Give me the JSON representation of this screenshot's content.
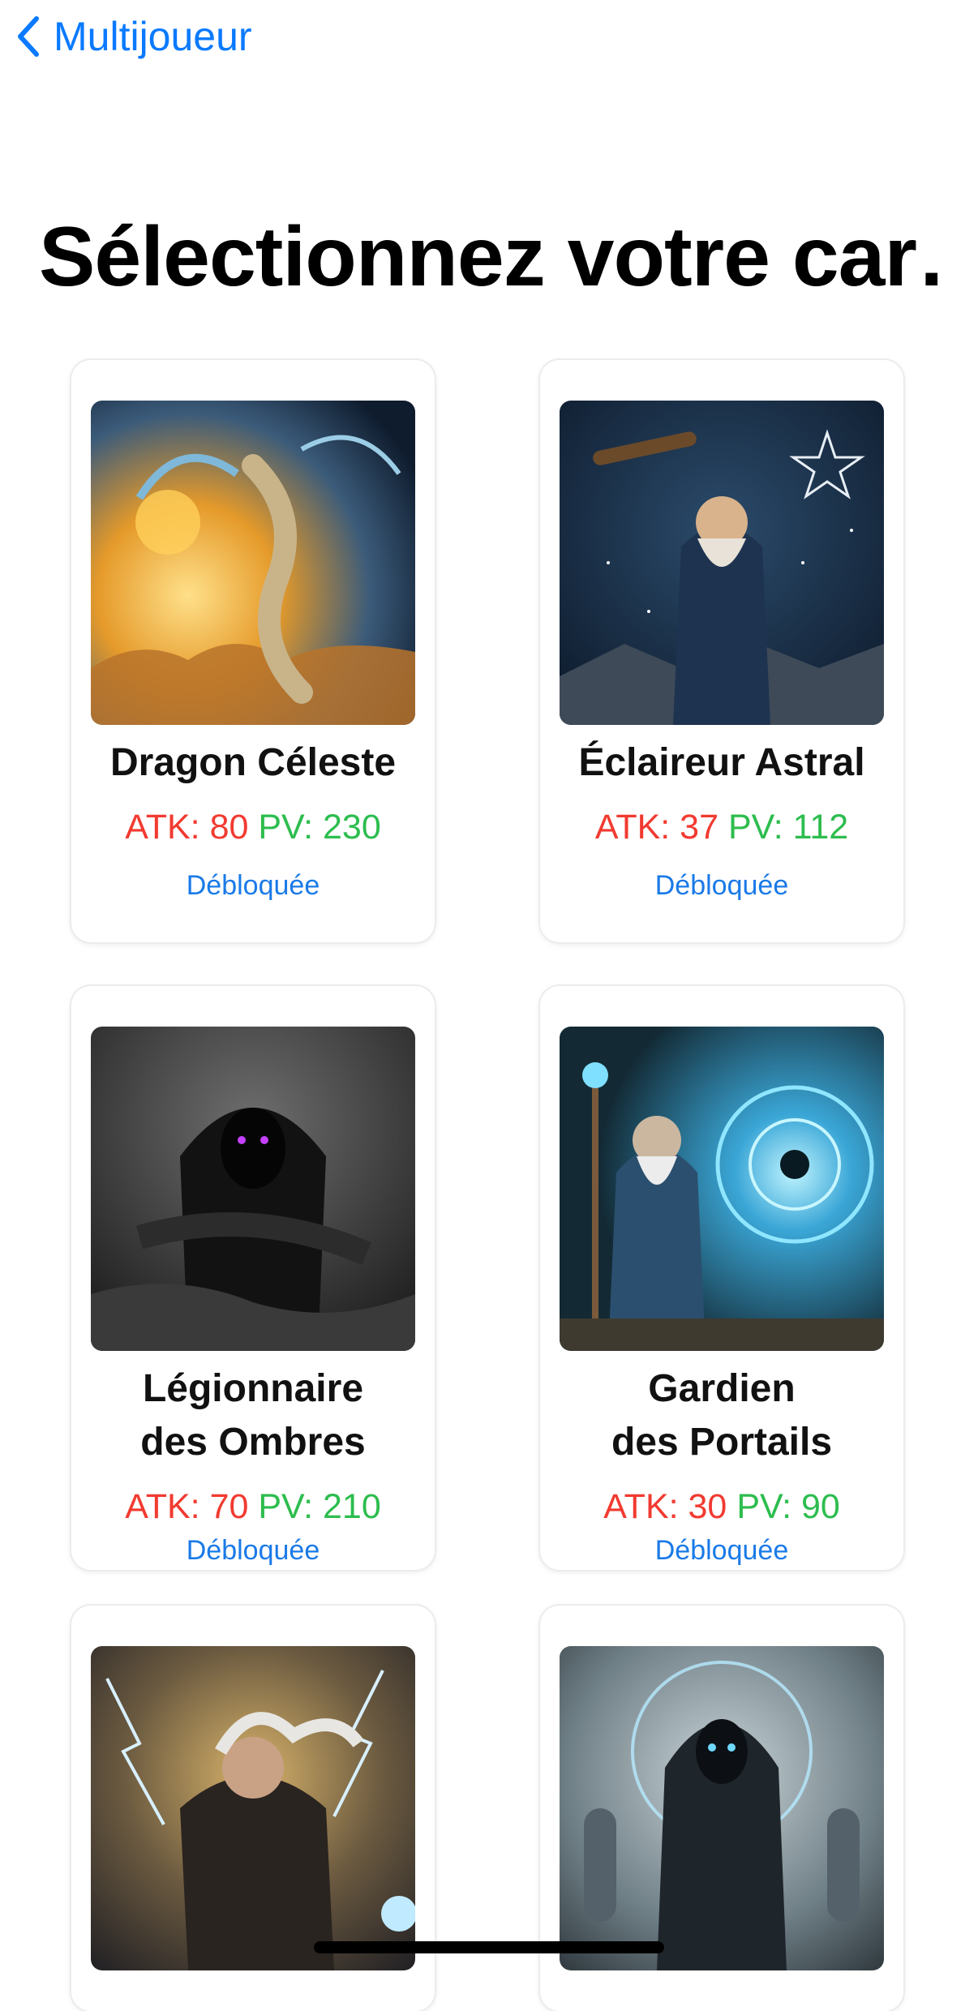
{
  "nav": {
    "back_label": "Multijoueur"
  },
  "page": {
    "title": "Sélectionnez votre car…"
  },
  "cards": [
    {
      "name": "Dragon Céleste",
      "atk_label": "ATK: 80",
      "pv_label": "PV: 230",
      "status": "Débloquée"
    },
    {
      "name": "Éclaireur Astral",
      "atk_label": "ATK: 37",
      "pv_label": "PV: 112",
      "status": "Débloquée"
    },
    {
      "name_line1": "Légionnaire",
      "name_line2": "des Ombres",
      "atk_label": "ATK: 70",
      "pv_label": "PV: 210",
      "status": "Débloquée"
    },
    {
      "name_line1": "Gardien",
      "name_line2": "des Portails",
      "atk_label": "ATK: 30",
      "pv_label": "PV: 90",
      "status": "Débloquée"
    },
    {},
    {}
  ],
  "colors": {
    "accent": "#0a7aff",
    "atk": "#f23a30",
    "pv": "#2dbd4e",
    "status": "#1a7ae8"
  },
  "icons": {
    "back": "chevron-left-icon"
  }
}
